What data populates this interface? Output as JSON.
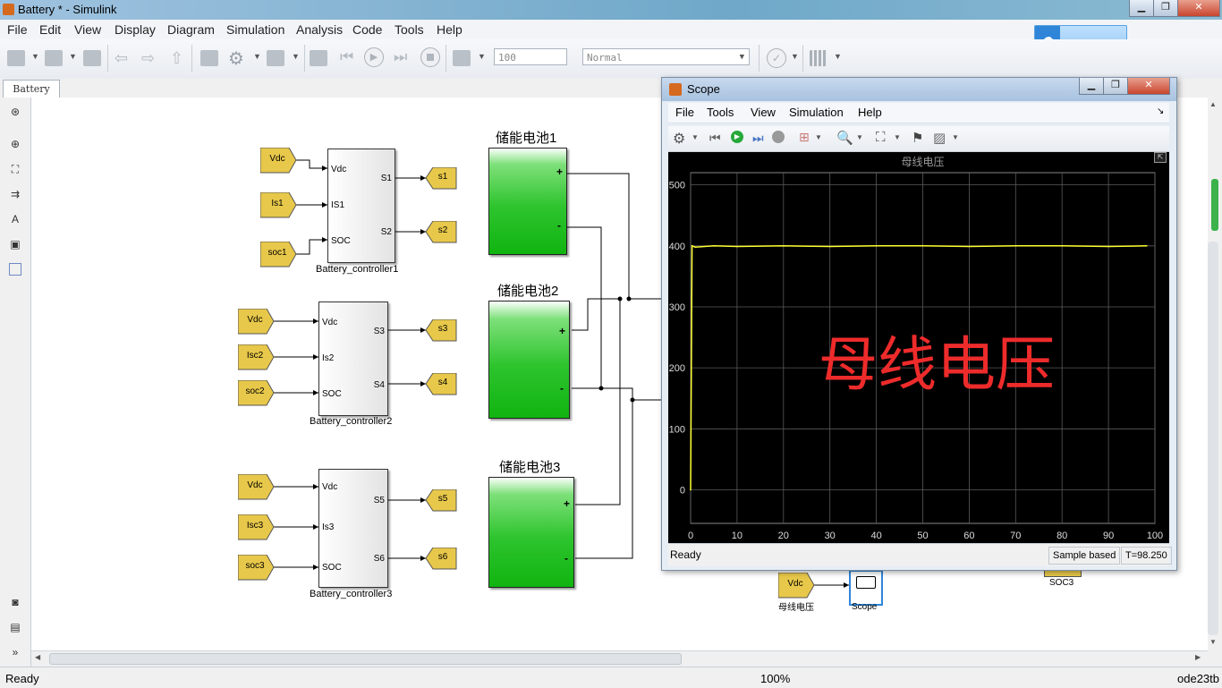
{
  "window": {
    "title": "Battery * - Simulink",
    "controls": {
      "minimize": "▁",
      "maximize": "❐",
      "close": "✕"
    }
  },
  "menu": [
    "File",
    "Edit",
    "View",
    "Display",
    "Diagram",
    "Simulation",
    "Analysis",
    "Code",
    "Tools",
    "Help"
  ],
  "toolbar": {
    "stop_time": "100",
    "sim_mode": "Normal"
  },
  "tabs": {
    "active": "Battery"
  },
  "diagram": {
    "controllers": [
      {
        "name": "Battery_controller1",
        "inputs": [
          "Vdc",
          "IS1",
          "SOC"
        ],
        "outputs": [
          "S1",
          "S2"
        ],
        "from_tags": [
          "Vdc",
          "Is1",
          "soc1"
        ],
        "goto_tags": [
          "s1",
          "s2"
        ]
      },
      {
        "name": "Battery_controller2",
        "inputs": [
          "Vdc",
          "Is2",
          "SOC"
        ],
        "outputs": [
          "S3",
          "S4"
        ],
        "from_tags": [
          "Vdc",
          "Isc2",
          "soc2"
        ],
        "goto_tags": [
          "s3",
          "s4"
        ]
      },
      {
        "name": "Battery_controller3",
        "inputs": [
          "Vdc",
          "Is3",
          "SOC"
        ],
        "outputs": [
          "S5",
          "S6"
        ],
        "from_tags": [
          "Vdc",
          "Isc3",
          "soc3"
        ],
        "goto_tags": [
          "s5",
          "s6"
        ]
      }
    ],
    "batteries": [
      {
        "title": "储能电池1",
        "plus": "+",
        "minus": "-"
      },
      {
        "title": "储能电池2",
        "plus": "+",
        "minus": "-"
      },
      {
        "title": "储能电池3",
        "plus": "+",
        "minus": "-"
      }
    ],
    "scope_block": {
      "input_tag": "Vdc",
      "input_label": "母线电压",
      "name": "Scope"
    },
    "soc3_label": "SOC3",
    "colors": {
      "goto_fill": "#e8c84a",
      "battery_green": "#22bb22"
    }
  },
  "scope": {
    "title": "Scope",
    "menu": [
      "File",
      "Tools",
      "View",
      "Simulation",
      "Help"
    ],
    "status": {
      "left": "Ready",
      "mode": "Sample based",
      "time": "T=98.250"
    },
    "overlay_text": "母线电压"
  },
  "chart_data": {
    "type": "line",
    "title": "母线电压",
    "xlabel": "",
    "ylabel": "",
    "xlim": [
      0,
      100
    ],
    "ylim": [
      -55,
      520
    ],
    "xticks": [
      0,
      10,
      20,
      30,
      40,
      50,
      60,
      70,
      80,
      90,
      100
    ],
    "yticks": [
      0,
      100,
      200,
      300,
      400,
      500
    ],
    "grid": true,
    "series": [
      {
        "color": "#ffff33",
        "x": [
          0,
          0.3,
          1,
          5,
          10,
          20,
          30,
          40,
          50,
          60,
          70,
          80,
          90,
          98.25
        ],
        "y": [
          0,
          400,
          398,
          400,
          399,
          400,
          399,
          400,
          400,
          399,
          400,
          400,
          399,
          400
        ]
      }
    ]
  },
  "statusbar": {
    "left": "Ready",
    "zoom": "100%",
    "solver": "ode23tb"
  }
}
